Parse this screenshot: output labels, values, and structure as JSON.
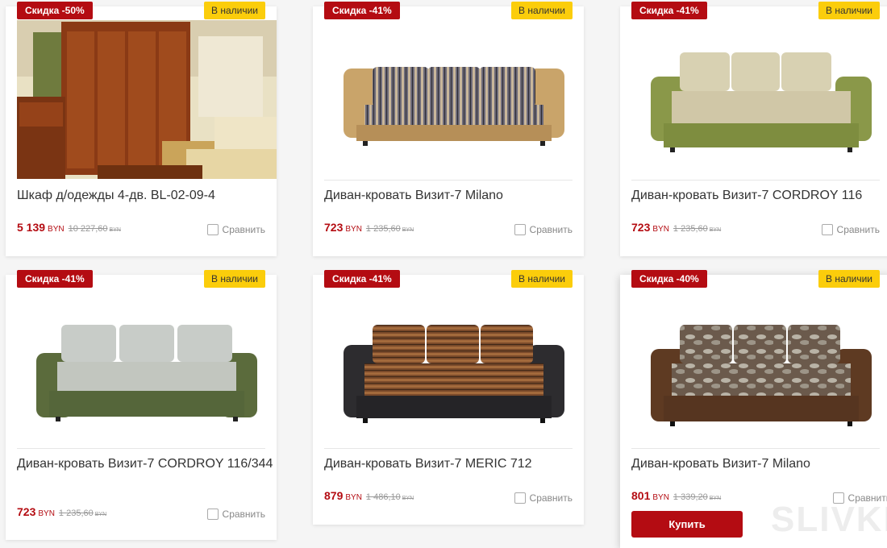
{
  "products": [
    {
      "sale": "Скидка -50%",
      "stock": "В наличии",
      "name": "Шкаф д/одежды 4-дв. BL-02-09-4",
      "price": "5 139",
      "currency": "BYN",
      "old_price": "10 227,60",
      "old_currency": "BYN",
      "compare": "Сравнить"
    },
    {
      "sale": "Скидка -41%",
      "stock": "В наличии",
      "name": "Диван-кровать Визит-7 Milano",
      "price": "723",
      "currency": "BYN",
      "old_price": "1 235,60",
      "old_currency": "BYN",
      "compare": "Сравнить"
    },
    {
      "sale": "Скидка -41%",
      "stock": "В наличии",
      "name": "Диван-кровать Визит-7 CORDROY 116",
      "price": "723",
      "currency": "BYN",
      "old_price": "1 235,60",
      "old_currency": "BYN",
      "compare": "Сравнить"
    },
    {
      "sale": "Скидка -41%",
      "stock": "В наличии",
      "name": "Диван-кровать Визит-7 CORDROY 116/344",
      "price": "723",
      "currency": "BYN",
      "old_price": "1 235,60",
      "old_currency": "BYN",
      "compare": "Сравнить"
    },
    {
      "sale": "Скидка -41%",
      "stock": "В наличии",
      "name": "Диван-кровать Визит-7 MERIC 712",
      "price": "879",
      "currency": "BYN",
      "old_price": "1 486,10",
      "old_currency": "BYN",
      "compare": "Сравнить"
    },
    {
      "sale": "Скидка -40%",
      "stock": "В наличии",
      "name": "Диван-кровать Визит-7 Milano",
      "price": "801",
      "currency": "BYN",
      "old_price": "1 339,20",
      "old_currency": "BYN",
      "compare": "Сравнить",
      "buy": "Купить"
    }
  ],
  "watermark": "SLIVKI",
  "colors": {
    "accent": "#b40c12",
    "stock_badge": "#fbcd0b"
  },
  "images": [
    "wardrobe-photo",
    "sofa-striped-beige",
    "sofa-olive-cream",
    "sofa-green-grey",
    "sofa-brown-black",
    "sofa-patterned-brown"
  ]
}
